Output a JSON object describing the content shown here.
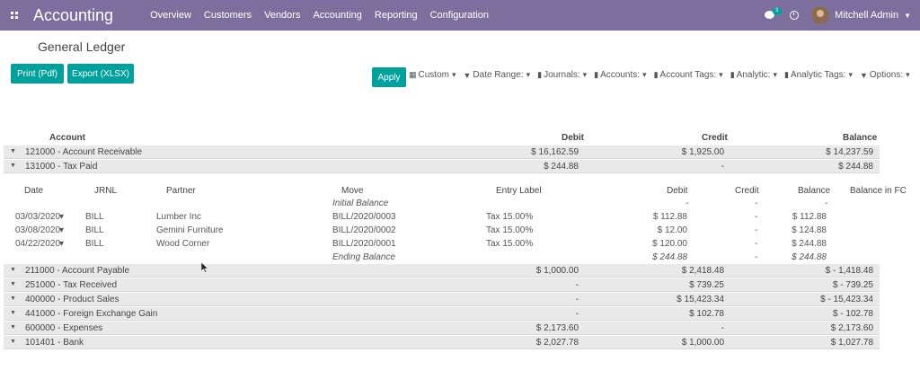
{
  "navbar": {
    "brand": "Accounting",
    "menu": [
      "Overview",
      "Customers",
      "Vendors",
      "Accounting",
      "Reporting",
      "Configuration"
    ],
    "chat_badge": "3",
    "user_name": "Mitchell Admin"
  },
  "page": {
    "title": "General Ledger",
    "print_label": "Print (Pdf)",
    "export_label": "Export (XLSX)",
    "apply_label": "Apply"
  },
  "filters": [
    {
      "icon": "calendar-icon",
      "label": "Custom"
    },
    {
      "icon": "filter-icon",
      "label": "Date Range:"
    },
    {
      "icon": "book-icon",
      "label": "Journals:"
    },
    {
      "icon": "book-icon",
      "label": "Accounts:"
    },
    {
      "icon": "book-icon",
      "label": "Account Tags:"
    },
    {
      "icon": "book-icon",
      "label": "Analytic:"
    },
    {
      "icon": "book-icon",
      "label": "Analytic Tags:"
    },
    {
      "icon": "filter-icon",
      "label": "Options:"
    }
  ],
  "columns": {
    "account": "Account",
    "debit": "Debit",
    "credit": "Credit",
    "balance": "Balance"
  },
  "accounts_top": [
    {
      "name": "121000 - Account Receivable",
      "debit": "$ 16,162.59",
      "credit": "$ 1,925.00",
      "balance": "$ 14,237.59"
    },
    {
      "name": "131000 - Tax Paid",
      "debit": "$ 244.88",
      "credit": "-",
      "balance": "$ 244.88"
    }
  ],
  "detail_columns": {
    "date": "Date",
    "jrnl": "JRNL",
    "partner": "Partner",
    "move": "Move",
    "entry_label": "Entry Label",
    "debit": "Debit",
    "credit": "Credit",
    "balance": "Balance",
    "balance_fc": "Balance in FC"
  },
  "initial_balance": {
    "label": "Initial Balance",
    "debit": "-",
    "credit": "-",
    "balance": "-"
  },
  "lines": [
    {
      "date": "03/03/2020",
      "jrnl": "BILL",
      "partner": "Lumber Inc",
      "move": "BILL/2020/0003",
      "entry": "Tax 15.00%",
      "debit": "$ 112.88",
      "credit": "-",
      "balance": "$ 112.88"
    },
    {
      "date": "03/08/2020",
      "jrnl": "BILL",
      "partner": "Gemini Furniture",
      "move": "BILL/2020/0002",
      "entry": "Tax 15.00%",
      "debit": "$ 12.00",
      "credit": "-",
      "balance": "$ 124.88"
    },
    {
      "date": "04/22/2020",
      "jrnl": "BILL",
      "partner": "Wood Corner",
      "move": "BILL/2020/0001",
      "entry": "Tax 15.00%",
      "debit": "$ 120.00",
      "credit": "-",
      "balance": "$ 244.88"
    }
  ],
  "ending_balance": {
    "label": "Ending Balance",
    "debit": "$ 244.88",
    "credit": "-",
    "balance": "$ 244.88"
  },
  "accounts_bottom": [
    {
      "name": "211000 - Account Payable",
      "debit": "$ 1,000.00",
      "credit": "$ 2,418.48",
      "balance": "$ - 1,418.48"
    },
    {
      "name": "251000 - Tax Received",
      "debit": "-",
      "credit": "$ 739.25",
      "balance": "$ - 739.25"
    },
    {
      "name": "400000 - Product Sales",
      "debit": "-",
      "credit": "$ 15,423.34",
      "balance": "$ - 15,423.34"
    },
    {
      "name": "441000 - Foreign Exchange Gain",
      "debit": "-",
      "credit": "$ 102.78",
      "balance": "$ - 102.78"
    },
    {
      "name": "600000 - Expenses",
      "debit": "$ 2,173.60",
      "credit": "-",
      "balance": "$ 2,173.60"
    },
    {
      "name": "101401 - Bank",
      "debit": "$ 2,027.78",
      "credit": "$ 1,000.00",
      "balance": "$ 1,027.78"
    }
  ],
  "colors": {
    "navbar": "#7c6f9e",
    "accent": "#00a09d",
    "row_bg": "#e9e9e9"
  }
}
